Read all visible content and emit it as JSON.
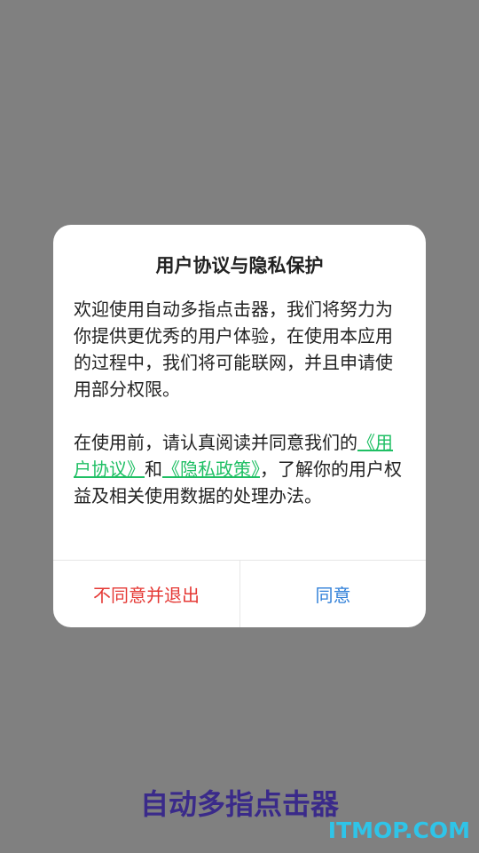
{
  "dialog": {
    "title": "用户协议与隐私保护",
    "para1": "欢迎使用自动多指点击器，我们将努力为你提供更优秀的用户体验，在使用本应用的过程中，我们将可能联网，并且申请使用部分权限。",
    "para2_prefix": "在使用前，请认真阅读并同意我们的",
    "user_agreement_link": "《用户协议》",
    "and_text": "和",
    "privacy_policy_link": "《隐私政策》",
    "para2_suffix": "，了解你的用户权益及相关使用数据的处理办法。",
    "disagree_button": "不同意并退出",
    "agree_button": "同意"
  },
  "app_name": "自动多指点击器",
  "watermark": "ITMOP.COM",
  "colors": {
    "overlay": "#808080",
    "link": "#1fbf64",
    "disagree": "#e53935",
    "agree": "#2f7fd8",
    "app_name": "#3a2a8a",
    "watermark": "#2fc4e8"
  }
}
